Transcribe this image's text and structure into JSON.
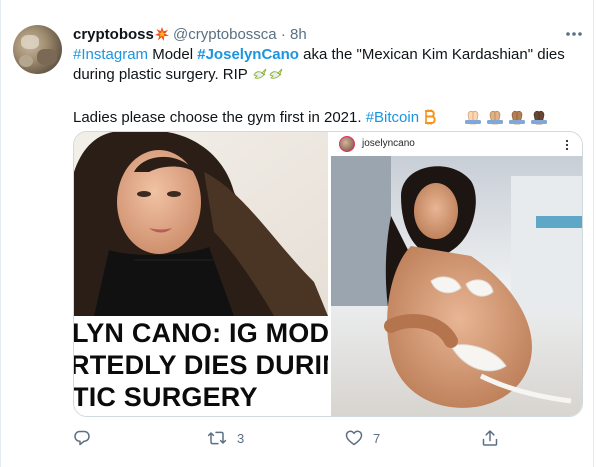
{
  "tweet": {
    "display_name": "cryptoboss",
    "name_emoji": "collision-emoji",
    "handle": "@cryptobossca",
    "separator": "·",
    "time": "8h",
    "more_icon": "more-horizontal-icon",
    "line1": {
      "hashtag_instagram": "#Instagram",
      "text_model": " Model ",
      "hashtag_name": "#JoselynCano",
      "text_rest": " aka the \"Mexican Kim Kardashian\" dies during plastic surgery. RIP"
    },
    "line1_emoji": [
      "dove-emoji",
      "dove-emoji"
    ],
    "line2": {
      "text": "Ladies please choose the gym first in 2021. ",
      "hashtag_bitcoin": "#Bitcoin"
    },
    "line2_emoji": [
      "bitcoin-emoji",
      "folded-hands-emoji",
      "folded-hands-emoji",
      "folded-hands-emoji",
      "folded-hands-emoji"
    ],
    "media": {
      "left_headline": [
        "LYN CANO: IG MODEL",
        "RTEDLY DIES DURING",
        "TIC SURGERY"
      ],
      "right_username": "joselyncano"
    },
    "actions": {
      "reply_icon": "reply-icon",
      "retweet_icon": "retweet-icon",
      "retweet_count": "3",
      "like_icon": "heart-icon",
      "like_count": "7",
      "share_icon": "share-icon"
    }
  },
  "colors": {
    "link": "#1b95e0",
    "muted": "#5b7083",
    "text": "#0f1419",
    "border": "#cfd9de"
  }
}
